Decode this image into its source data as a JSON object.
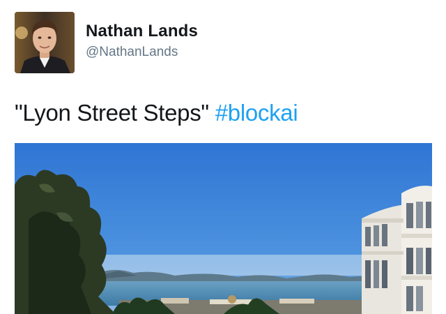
{
  "tweet": {
    "author_name": "Nathan Lands",
    "author_handle": "@NathanLands",
    "text": "\"Lyon Street Steps\"",
    "hashtag": "#blockai"
  },
  "colors": {
    "name": "#14171a",
    "handle": "#657786",
    "hashtag": "#1da1f2",
    "sky": "#2f79d6",
    "water": "#5a93b8"
  },
  "icons": {
    "avatar": "profile-photo",
    "photo": "landscape-photo"
  }
}
